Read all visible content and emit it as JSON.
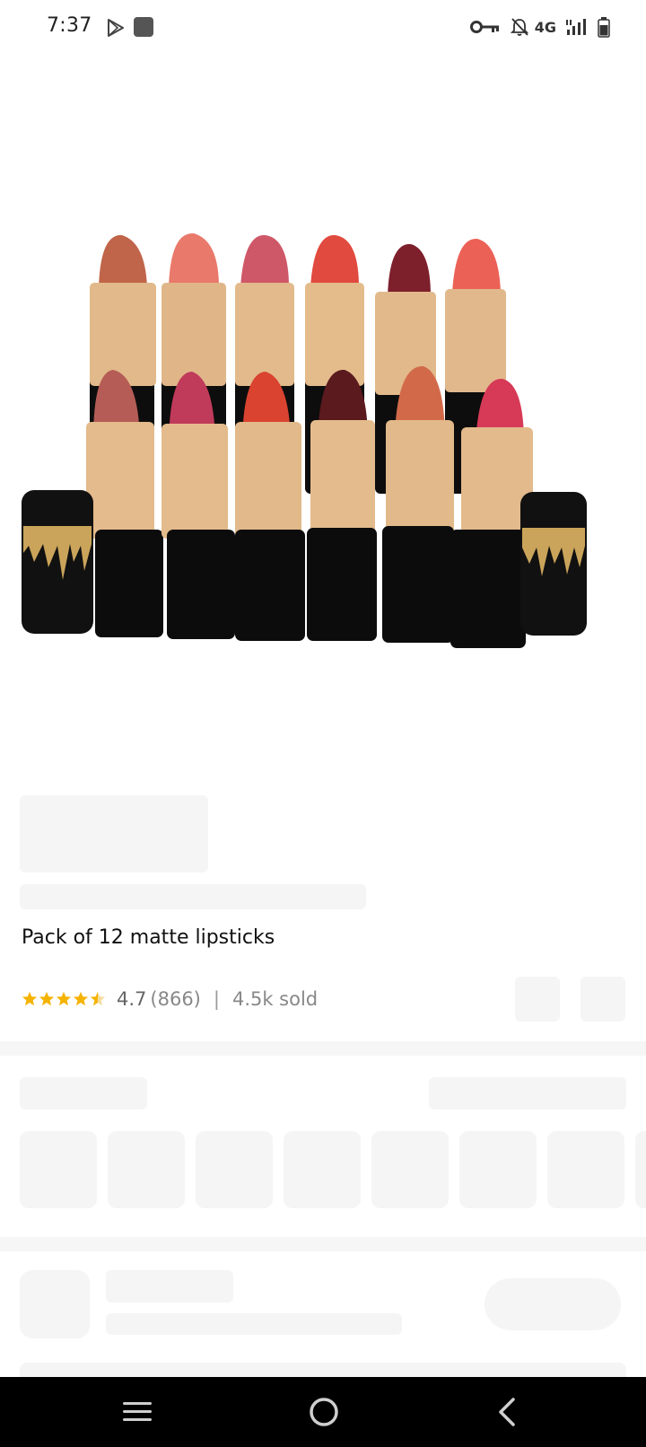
{
  "status_bar": {
    "time": "7:37",
    "network": "4G",
    "icons": [
      "play-store-icon",
      "gallery-icon",
      "vpn-key-icon",
      "notifications-off-icon",
      "signal-icon",
      "battery-icon"
    ]
  },
  "product": {
    "title": "Pack of 12 matte lipsticks",
    "rating": "4.7",
    "rating_count": "(866)",
    "separator": "|",
    "sold": "4.5k sold",
    "star_count": 4.5
  },
  "nav_bar": {
    "icons": [
      "recent-apps-icon",
      "home-icon",
      "back-icon"
    ]
  },
  "colors": {
    "star": "#f5b301",
    "skeleton": "#f5f5f5",
    "nav_bg": "#000000"
  }
}
